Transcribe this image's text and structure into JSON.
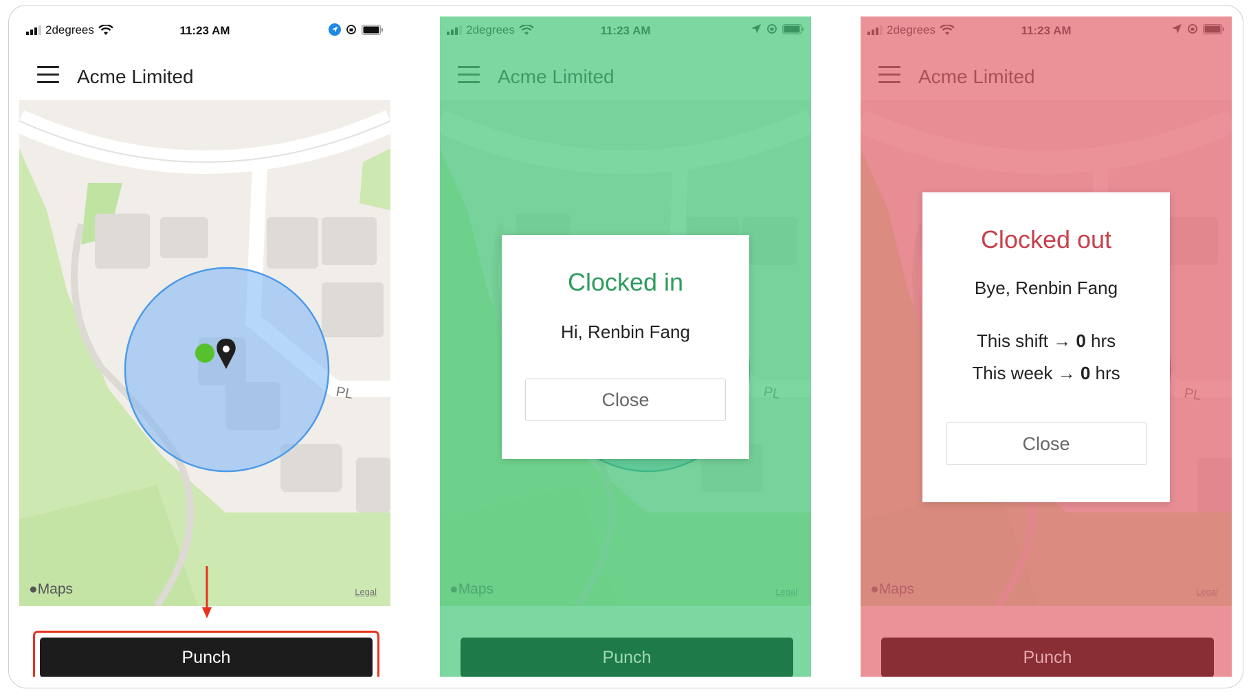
{
  "screens": [
    {
      "status": {
        "carrier": "2degrees",
        "time": "11:23 AM"
      },
      "app_title": "Acme Limited",
      "map": {
        "maps_label": "Maps",
        "legal": "Legal",
        "street_label": "PL"
      },
      "punch_label": "Punch"
    },
    {
      "status": {
        "carrier": "2degrees",
        "time": "11:23 AM"
      },
      "app_title": "Acme Limited",
      "map": {
        "maps_label": "Maps",
        "legal": "Legal",
        "street_label": "PL"
      },
      "punch_label": "Punch",
      "dialog": {
        "title": "Clocked in",
        "greeting": "Hi, Renbin Fang",
        "close_label": "Close"
      }
    },
    {
      "status": {
        "carrier": "2degrees",
        "time": "11:23 AM"
      },
      "app_title": "Acme Limited",
      "map": {
        "maps_label": "Maps",
        "legal": "Legal",
        "street_label": "PL"
      },
      "punch_label": "Punch",
      "dialog": {
        "title": "Clocked out",
        "greeting": "Bye, Renbin Fang",
        "shift_label": "This shift",
        "shift_hours": "0",
        "week_label": "This week",
        "week_hours": "0",
        "hours_unit": "hrs",
        "arrow": "→",
        "close_label": "Close"
      }
    }
  ],
  "colors": {
    "overlay_green": "#4ac87d",
    "overlay_red": "#e2646e",
    "clocked_in_title": "#2e9b5e",
    "clocked_out_title": "#c8404b",
    "punch_default": "#1c1c1c",
    "highlight": "#e8321e"
  },
  "icons": [
    "signal-icon",
    "wifi-icon",
    "location-arrow-icon",
    "orientation-lock-icon",
    "battery-icon",
    "hamburger-menu-icon",
    "map-pin-icon",
    "apple-logo-icon"
  ]
}
